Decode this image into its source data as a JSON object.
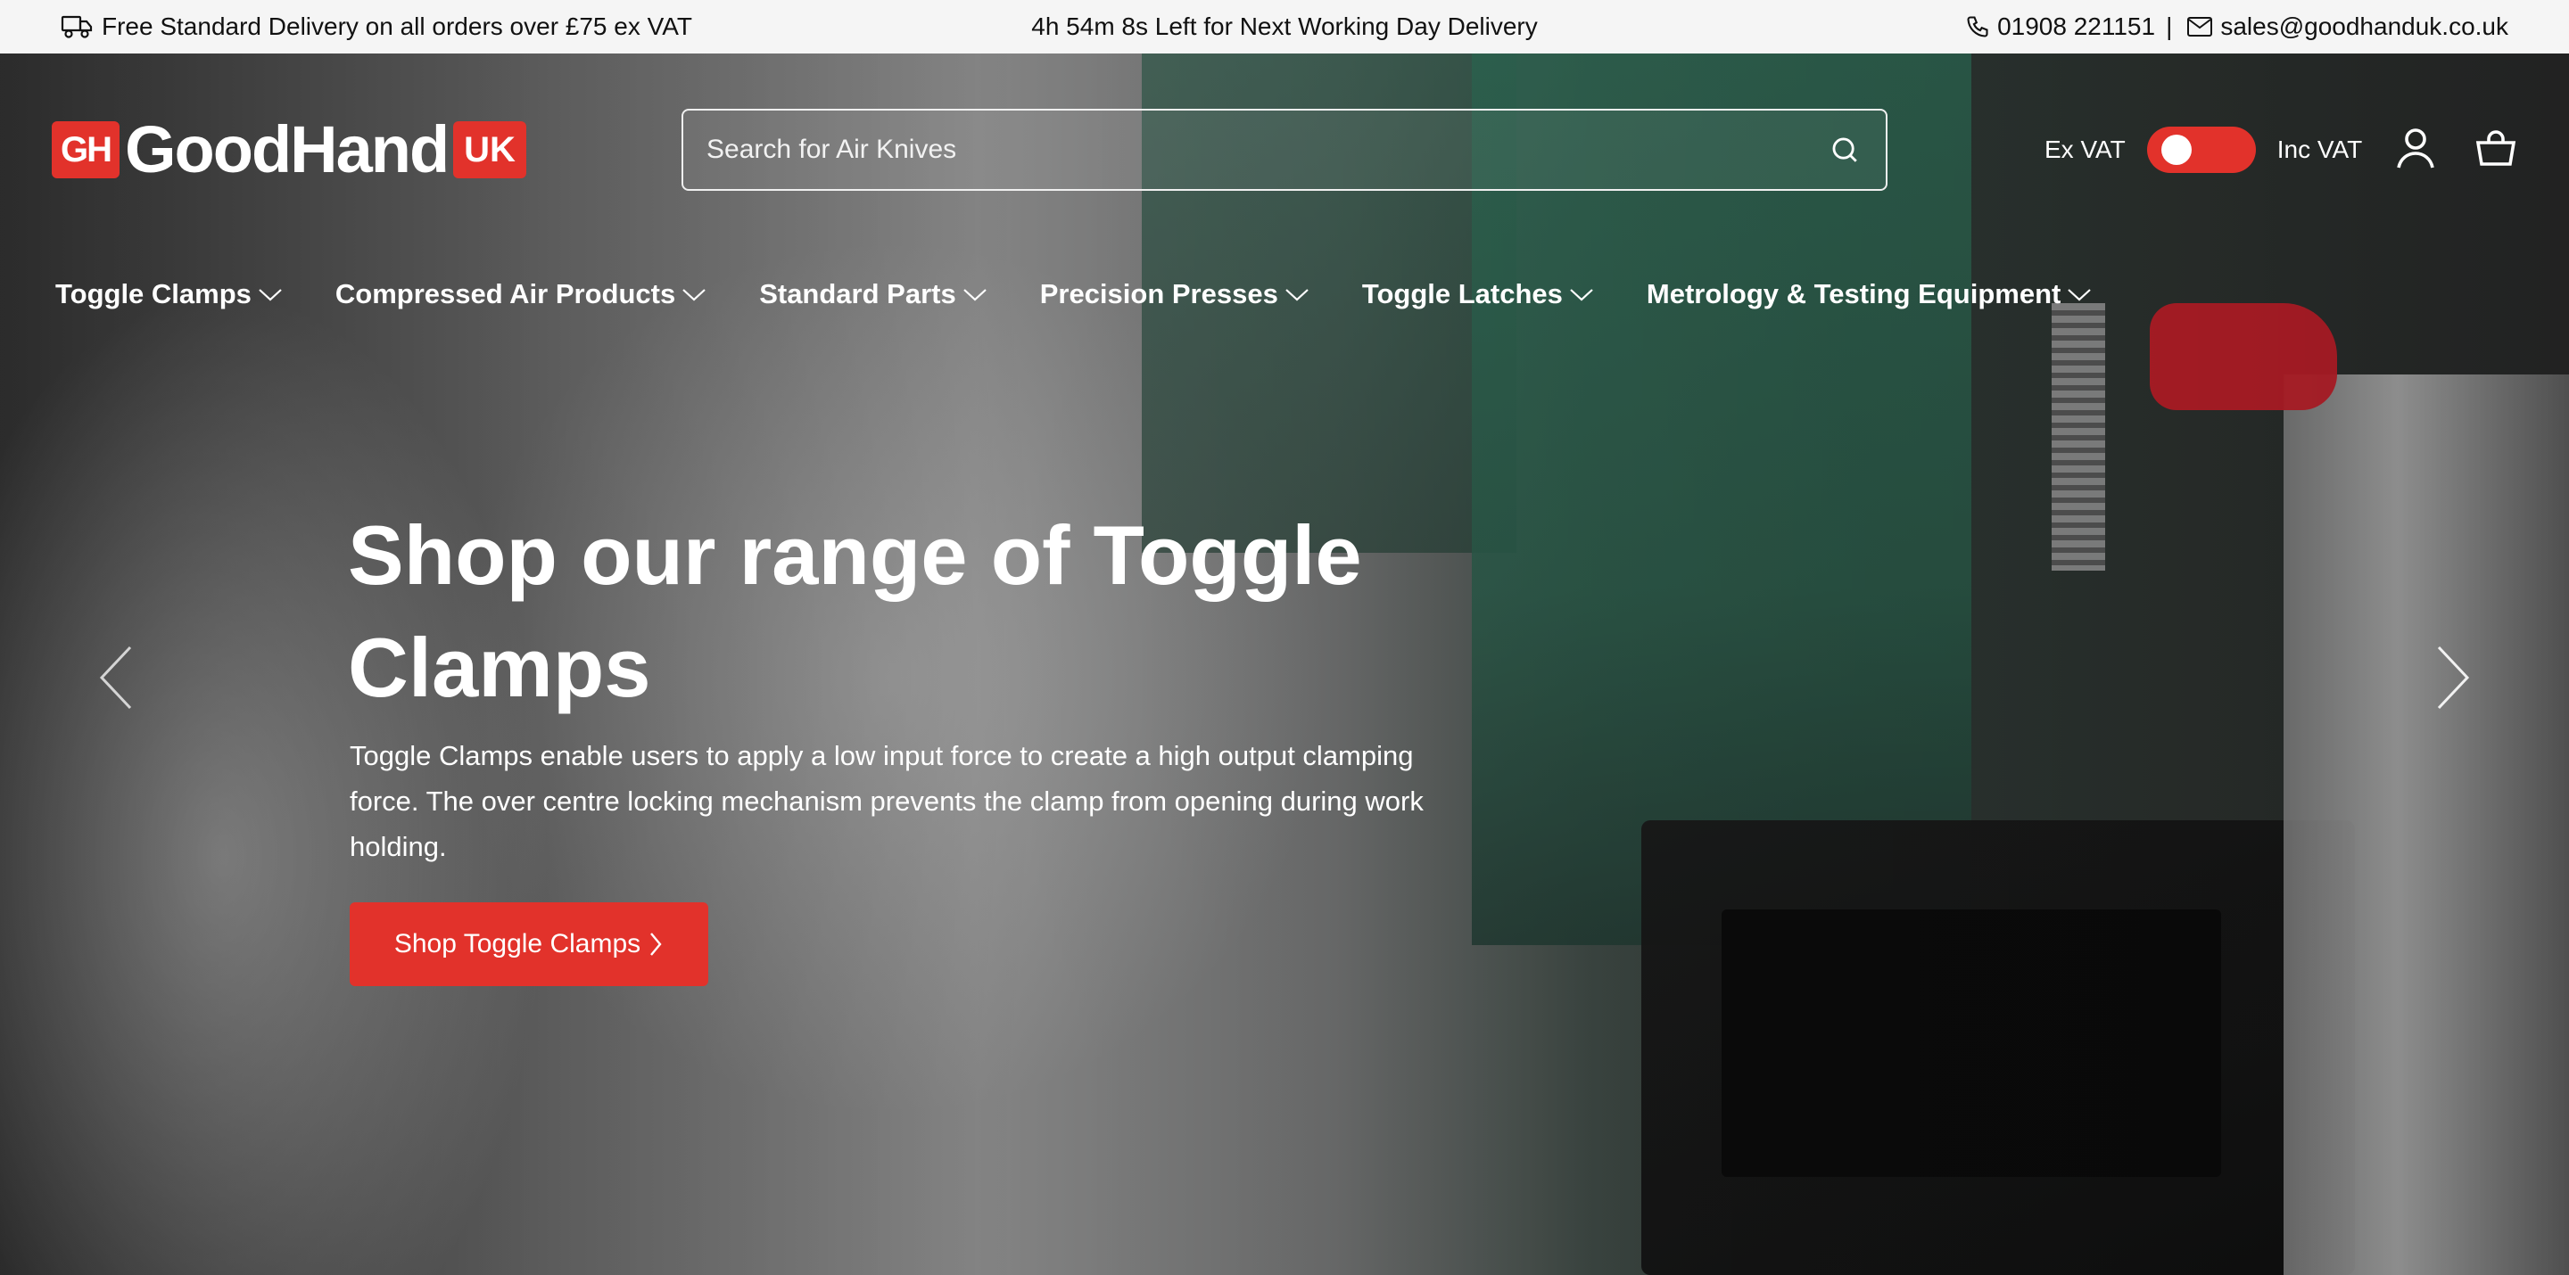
{
  "announcement": {
    "delivery_text": "Free Standard Delivery on all orders over £75 ex VAT",
    "countdown_text": "4h 54m 8s Left for Next Working Day Delivery",
    "phone": "01908 221151",
    "separator": "|",
    "email": "sales@goodhanduk.co.uk"
  },
  "header": {
    "logo": {
      "mark": "GH",
      "name": "GoodHand",
      "badge": "UK"
    },
    "search": {
      "placeholder": "Search for Air Knives"
    },
    "vat": {
      "ex_label": "Ex VAT",
      "inc_label": "Inc VAT"
    }
  },
  "nav": {
    "items": [
      {
        "label": "Toggle Clamps"
      },
      {
        "label": "Compressed Air Products"
      },
      {
        "label": "Standard Parts"
      },
      {
        "label": "Precision Presses"
      },
      {
        "label": "Toggle Latches"
      },
      {
        "label": "Metrology & Testing Equipment"
      }
    ]
  },
  "hero": {
    "title": "Shop our range of Toggle Clamps",
    "description": "Toggle Clamps enable users to apply a low input force to create a high output clamping force. The over centre locking mechanism prevents the clamp from opening during work holding.",
    "button_label": "Shop Toggle Clamps"
  },
  "colors": {
    "brand_red": "#e2322b",
    "topbar_bg": "#f5f5f5",
    "text_light": "#ffffff"
  },
  "icons": [
    "truck-icon",
    "phone-icon",
    "mail-icon",
    "search-icon",
    "account-icon",
    "basket-icon",
    "chevron-down-icon",
    "chevron-right-icon",
    "arrow-left-icon",
    "arrow-right-icon"
  ]
}
